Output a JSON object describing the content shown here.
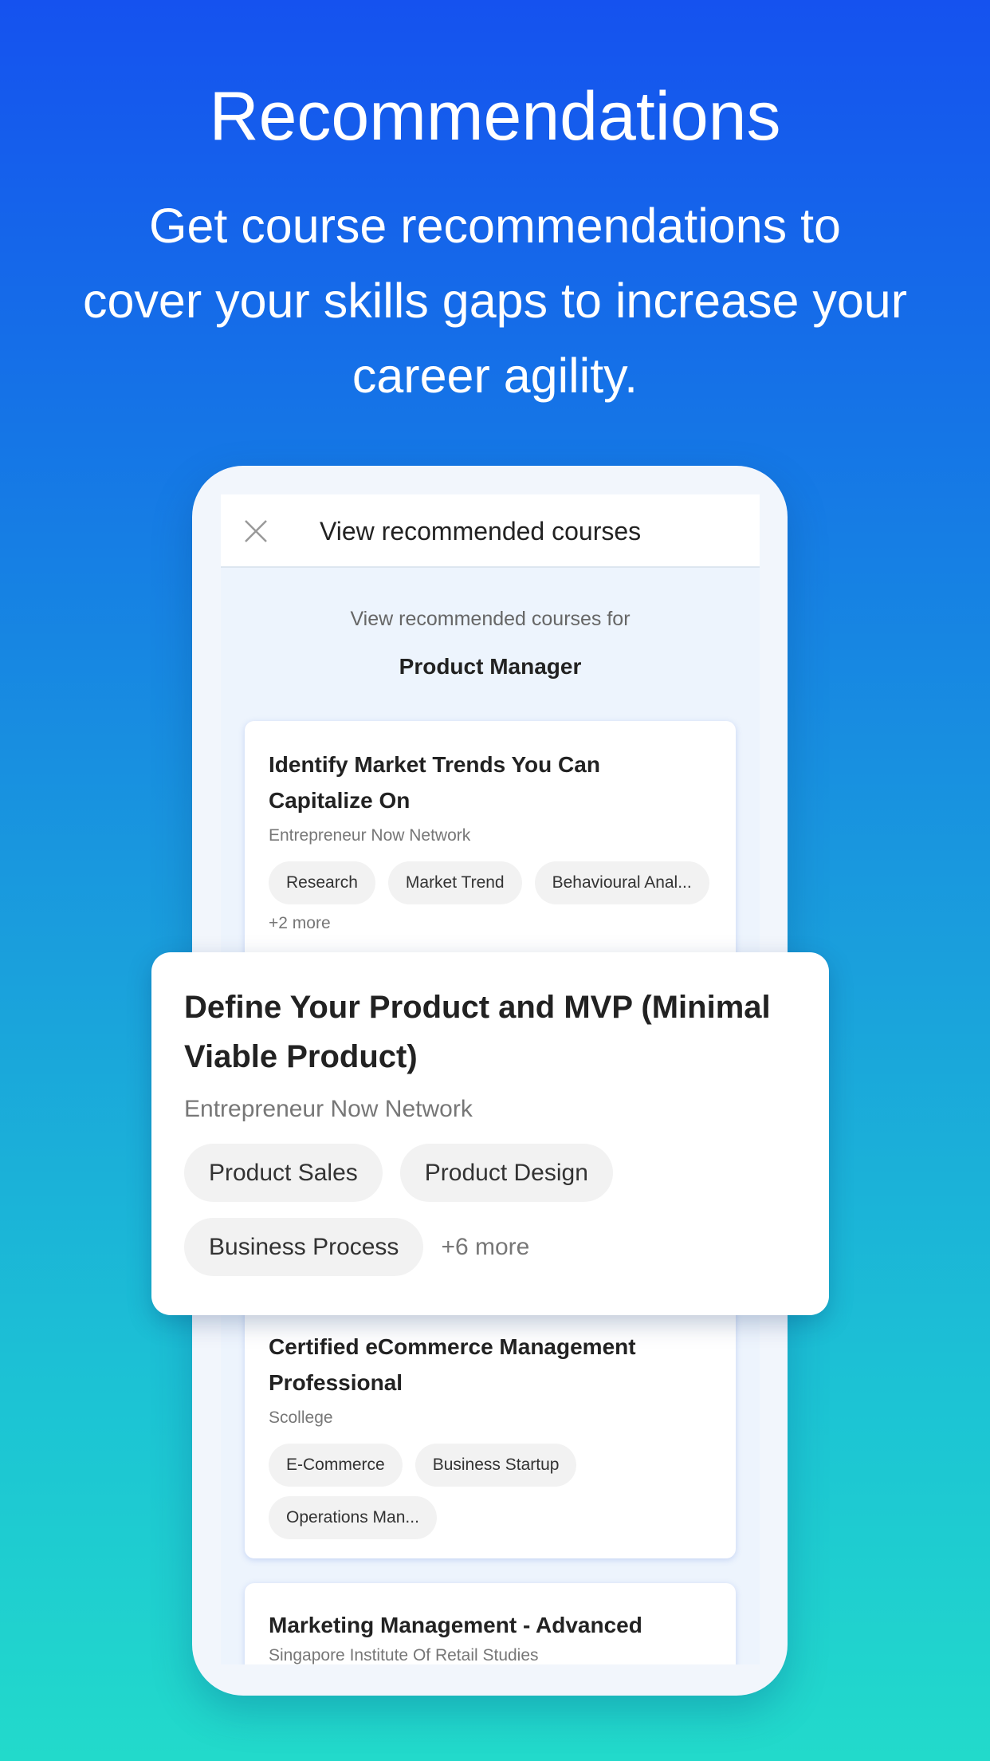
{
  "hero": {
    "title": "Recommendations",
    "subtitle_lines": [
      "Get course recommendations to",
      "cover your skills gaps to increase your",
      "career agility."
    ]
  },
  "screen": {
    "header_title": "View recommended courses",
    "for_label": "View recommended courses for",
    "role": "Product Manager"
  },
  "courses": [
    {
      "title": "Identify Market Trends You Can Capitalize On",
      "provider": "Entrepreneur Now Network",
      "tags": [
        "Research",
        "Market Trend",
        "Behavioural Anal..."
      ],
      "more": "+2 more"
    },
    {
      "title": "Define Your Product and MVP (Minimal Viable Product)",
      "provider": "Entrepreneur Now Network",
      "tags": [
        "Product Sales",
        "Product Design",
        "Business Process"
      ],
      "more": "+6 more"
    },
    {
      "title": "Certified eCommerce Management Professional",
      "provider": "Scollege",
      "tags": [
        "E-Commerce",
        "Business Startup",
        "Operations Man..."
      ]
    },
    {
      "title": "Marketing Management - Advanced",
      "provider": "Singapore Institute Of Retail Studies"
    }
  ]
}
